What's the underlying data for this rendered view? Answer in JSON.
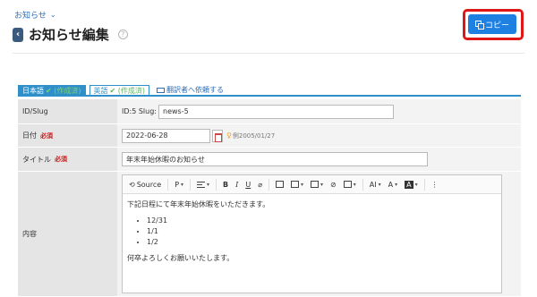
{
  "breadcrumb": {
    "label": "お知らせ"
  },
  "header": {
    "title": "お知らせ編集"
  },
  "copy_button": {
    "label": "コピー"
  },
  "language_tabs": [
    {
      "lang": "日本語",
      "status": "✔ (作成済)"
    },
    {
      "lang": "英語",
      "status": "✔ (作成済)"
    }
  ],
  "translate_link": "翻訳者へ依頼する",
  "form": {
    "slug": {
      "label": "ID/Slug",
      "prefix": "ID:5 Slug:",
      "value": "news-5"
    },
    "date": {
      "label": "日付",
      "required": "必須",
      "value": "2022-06-28",
      "hint": "例2005/01/27"
    },
    "title": {
      "label": "タイトル",
      "required": "必須",
      "value": "年末年始休暇のお知らせ"
    },
    "content": {
      "label": "内容"
    }
  },
  "editor": {
    "toolbar": {
      "source": "Source",
      "paragraph": "P",
      "bold": "B",
      "italic": "I",
      "underline": "U",
      "font_size": "AI",
      "font_color": "A",
      "bg_color": "A",
      "more": "⋮"
    },
    "body": {
      "intro": "下記日程にて年末年始休暇をいただきます。",
      "items": [
        "12/31",
        "1/1",
        "1/2"
      ],
      "outro": "何卒よろしくお願いいたします。"
    }
  },
  "colors": {
    "accent": "#1e80e0",
    "highlight": "#e11616",
    "tab_active": "#2e8fc9",
    "required": "#d01515"
  }
}
